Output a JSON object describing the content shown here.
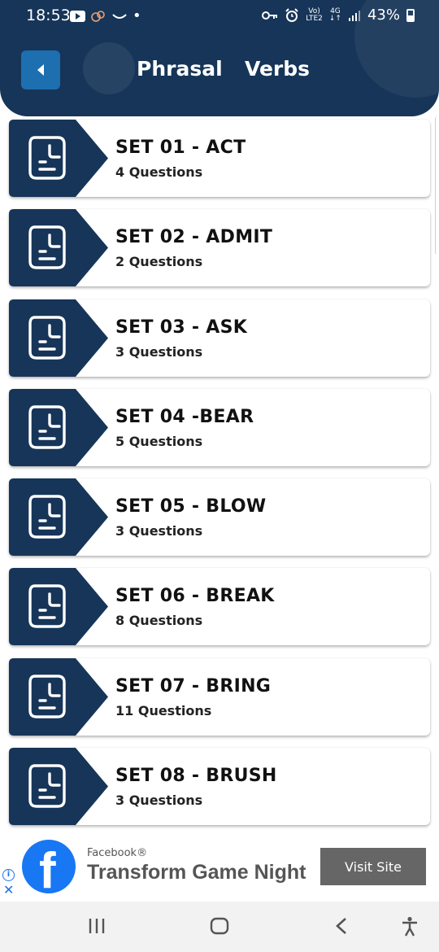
{
  "status_bar": {
    "time": "18:53",
    "network_label_top": "Vo)",
    "network_label_bottom": "LTE2",
    "network_gen_top": "4G",
    "network_gen_bottom": "↓↑",
    "battery": "43%"
  },
  "header": {
    "title_word1": "Phrasal",
    "title_word2": "Verbs",
    "back_icon": "chevron-left-icon"
  },
  "sets": [
    {
      "title": "SET 01 - ACT",
      "subtitle": "4 Questions"
    },
    {
      "title": "SET 02 - ADMIT",
      "subtitle": "2 Questions"
    },
    {
      "title": "SET 03 - ASK",
      "subtitle": "3 Questions"
    },
    {
      "title": "SET 04 -BEAR",
      "subtitle": "5 Questions"
    },
    {
      "title": "SET 05 - BLOW",
      "subtitle": "3 Questions"
    },
    {
      "title": "SET 06 - BREAK",
      "subtitle": "8 Questions"
    },
    {
      "title": "SET 07 - BRING",
      "subtitle": "11 Questions"
    },
    {
      "title": "SET 08 - BRUSH",
      "subtitle": "3 Questions"
    }
  ],
  "ad": {
    "brand": "Facebook®",
    "headline": "Transform Game Night",
    "cta": "Visit Site",
    "logo_letter": "f"
  },
  "colors": {
    "primary": "#163558",
    "accent": "#1d6fb0",
    "facebook_blue": "#1877f2"
  }
}
